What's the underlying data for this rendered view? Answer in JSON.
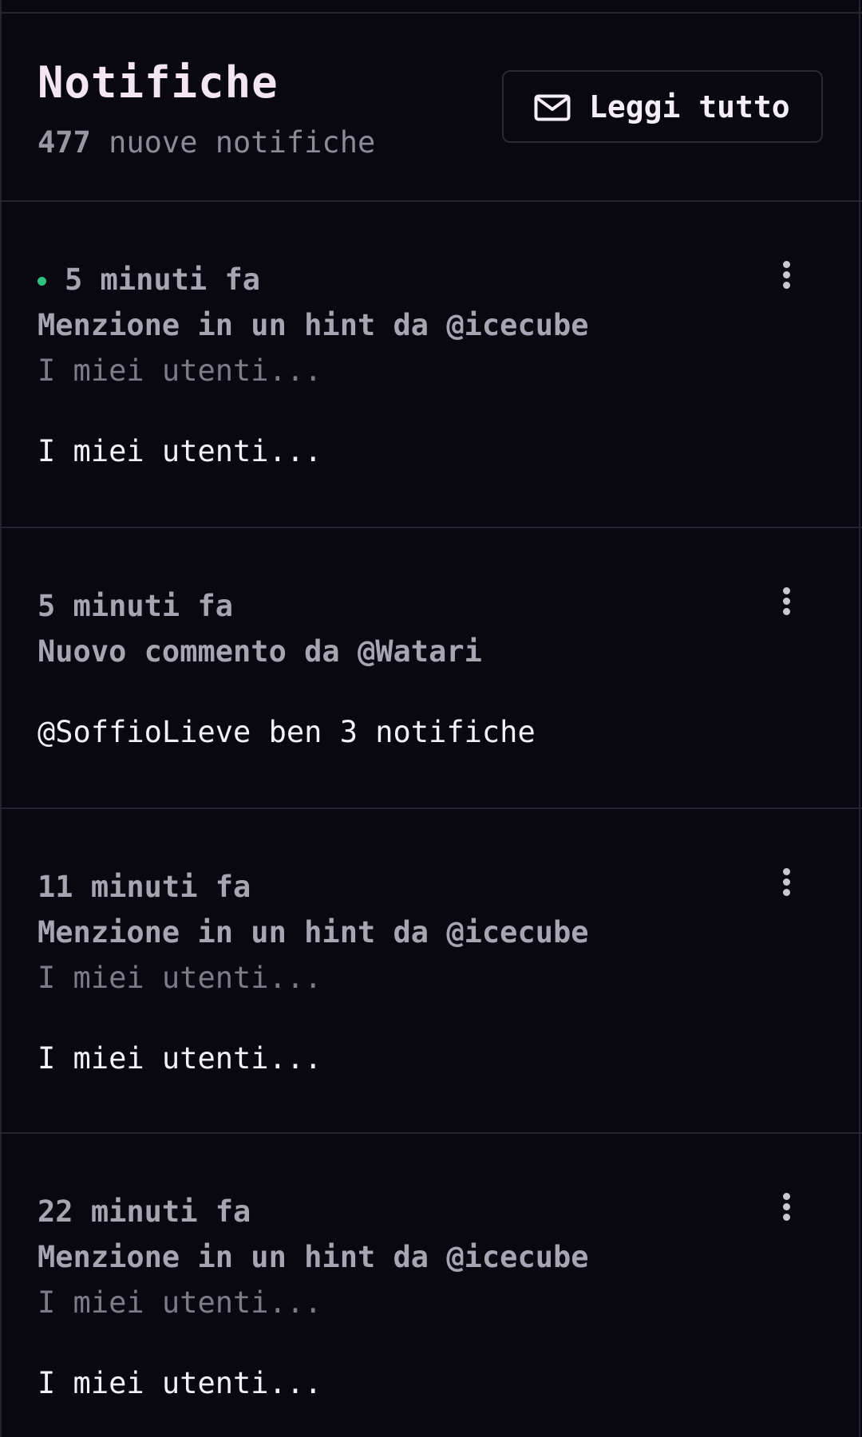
{
  "header": {
    "title": "Notifiche",
    "count": "477",
    "count_suffix": " nuove notifiche",
    "read_all_label": "Leggi tutto",
    "read_all_icon": "envelope-icon"
  },
  "colors": {
    "background": "#09070f",
    "divider": "#25232d",
    "unread_dot": "#2ec27e",
    "title": "#f3e6f2"
  },
  "notifications": [
    {
      "time": "5 minuti fa",
      "unread": true,
      "title": "Menzione in un hint da @icecube",
      "excerpt": "I miei utenti...",
      "body": "I miei utenti..."
    },
    {
      "time": "5 minuti fa",
      "unread": false,
      "title": "Nuovo commento da @Watari",
      "excerpt": "",
      "body": "@SoffioLieve ben 3 notifiche"
    },
    {
      "time": "11 minuti fa",
      "unread": false,
      "title": "Menzione in un hint da @icecube",
      "excerpt": "I miei utenti...",
      "body": "I miei utenti..."
    },
    {
      "time": "22 minuti fa",
      "unread": false,
      "title": "Menzione in un hint da @icecube",
      "excerpt": "I miei utenti...",
      "body": "I miei utenti..."
    }
  ]
}
